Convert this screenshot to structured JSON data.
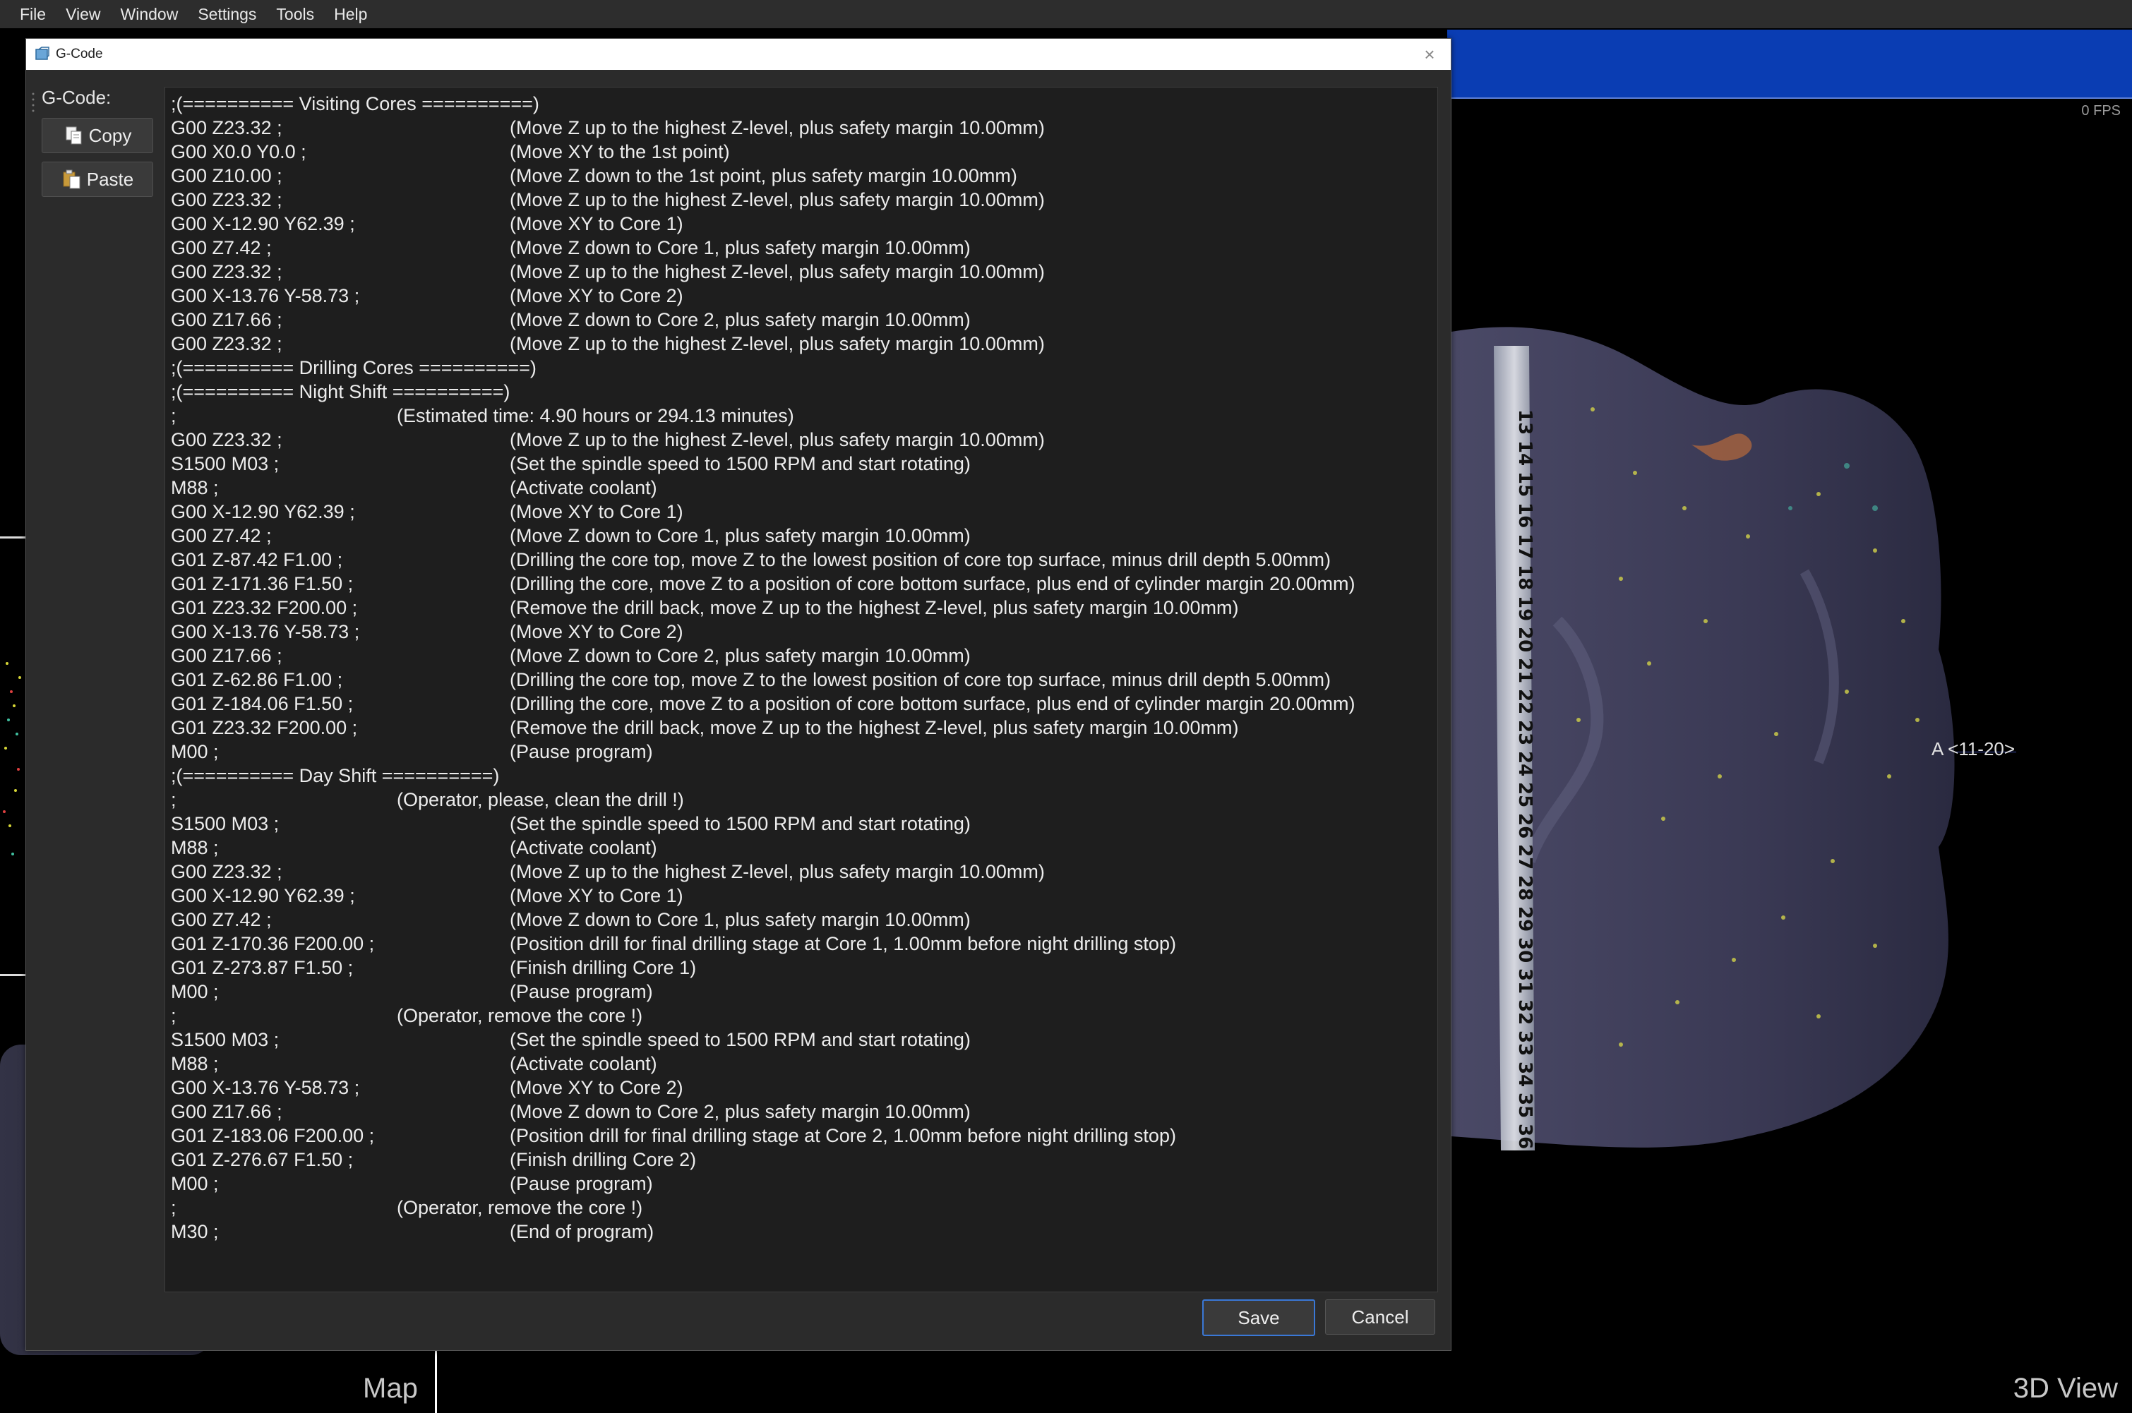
{
  "menu": [
    "File",
    "View",
    "Window",
    "Settings",
    "Tools",
    "Help"
  ],
  "viewport": {
    "fps": "0 FPS",
    "map_label": "Map",
    "view_label": "3D View",
    "axis_label": "A <11-20>"
  },
  "dialog": {
    "title": "G-Code",
    "gcode_label": "G-Code:",
    "copy_label": "Copy",
    "paste_label": "Paste",
    "save_label": "Save",
    "cancel_label": "Cancel",
    "lines": [
      {
        "c": ";(========== Visiting Cores ==========)",
        "m": ""
      },
      {
        "c": "G00 Z23.32 ;",
        "m": "(Move Z up to the highest Z-level, plus safety margin 10.00mm)"
      },
      {
        "c": "G00 X0.0 Y0.0 ;",
        "m": "(Move XY to the 1st point)"
      },
      {
        "c": "G00 Z10.00 ;",
        "m": "(Move Z down to the 1st point, plus safety margin 10.00mm)"
      },
      {
        "c": "G00 Z23.32 ;",
        "m": "(Move Z up to the highest Z-level, plus safety margin 10.00mm)"
      },
      {
        "c": "G00 X-12.90 Y62.39 ;",
        "m": "(Move XY to Core 1)"
      },
      {
        "c": "G00 Z7.42 ;",
        "m": "(Move Z down to Core 1, plus safety margin 10.00mm)"
      },
      {
        "c": "G00 Z23.32 ;",
        "m": "(Move Z up to the highest Z-level, plus safety margin 10.00mm)"
      },
      {
        "c": "G00 X-13.76 Y-58.73 ;",
        "m": "(Move XY to Core 2)"
      },
      {
        "c": "G00 Z17.66 ;",
        "m": "(Move Z down to Core 2, plus safety margin 10.00mm)"
      },
      {
        "c": "G00 Z23.32 ;",
        "m": "(Move Z up to the highest Z-level, plus safety margin 10.00mm)"
      },
      {
        "c": ";(========== Drilling Cores ==========)",
        "m": ""
      },
      {
        "c": ";(========== Night Shift ==========)",
        "m": ""
      },
      {
        "c": ";",
        "m": "(Estimated time: 4.90 hours or 294.13 minutes)",
        "center": true
      },
      {
        "c": "G00 Z23.32 ;",
        "m": "(Move Z up to the highest Z-level, plus safety margin 10.00mm)"
      },
      {
        "c": "S1500 M03 ;",
        "m": "(Set the spindle speed to 1500 RPM and start rotating)"
      },
      {
        "c": "M88 ;",
        "m": "(Activate coolant)"
      },
      {
        "c": "G00 X-12.90 Y62.39 ;",
        "m": "(Move XY to Core 1)"
      },
      {
        "c": "G00 Z7.42 ;",
        "m": "(Move Z down to Core 1, plus safety margin 10.00mm)"
      },
      {
        "c": "G01 Z-87.42 F1.00 ;",
        "m": "(Drilling the core top, move Z to the lowest position of core top surface, minus drill depth 5.00mm)"
      },
      {
        "c": "G01 Z-171.36 F1.50 ;",
        "m": "(Drilling the core, move Z to a position of core bottom surface, plus end of cylinder margin 20.00mm)"
      },
      {
        "c": "G01 Z23.32 F200.00 ;",
        "m": "(Remove the drill back, move Z up to the highest Z-level, plus safety margin 10.00mm)"
      },
      {
        "c": "G00 X-13.76 Y-58.73 ;",
        "m": "(Move XY to Core 2)"
      },
      {
        "c": "G00 Z17.66 ;",
        "m": "(Move Z down to Core 2, plus safety margin 10.00mm)"
      },
      {
        "c": "G01 Z-62.86 F1.00 ;",
        "m": "(Drilling the core top, move Z to the lowest position of core top surface, minus drill depth 5.00mm)"
      },
      {
        "c": "G01 Z-184.06 F1.50 ;",
        "m": "(Drilling the core, move Z to a position of core bottom surface, plus end of cylinder margin 20.00mm)"
      },
      {
        "c": "G01 Z23.32 F200.00 ;",
        "m": "(Remove the drill back, move Z up to the highest Z-level, plus safety margin 10.00mm)"
      },
      {
        "c": "M00 ;",
        "m": "(Pause program)"
      },
      {
        "c": ";(========== Day Shift ==========)",
        "m": ""
      },
      {
        "c": ";",
        "m": "(Operator, please, clean the drill !)",
        "center": true
      },
      {
        "c": "S1500 M03 ;",
        "m": "(Set the spindle speed to 1500 RPM and start rotating)"
      },
      {
        "c": "M88 ;",
        "m": "(Activate coolant)"
      },
      {
        "c": "G00 Z23.32 ;",
        "m": "(Move Z up to the highest Z-level, plus safety margin 10.00mm)"
      },
      {
        "c": "G00 X-12.90 Y62.39 ;",
        "m": "(Move XY to Core 1)"
      },
      {
        "c": "G00 Z7.42 ;",
        "m": "(Move Z down to Core 1, plus safety margin 10.00mm)"
      },
      {
        "c": "G01 Z-170.36 F200.00 ;",
        "m": "(Position drill for final drilling stage at Core 1, 1.00mm before night drilling stop)"
      },
      {
        "c": "G01 Z-273.87 F1.50 ;",
        "m": "(Finish drilling Core 1)"
      },
      {
        "c": "M00 ;",
        "m": "(Pause program)"
      },
      {
        "c": ";",
        "m": "(Operator, remove the core !)",
        "center": true
      },
      {
        "c": "S1500 M03 ;",
        "m": "(Set the spindle speed to 1500 RPM and start rotating)"
      },
      {
        "c": "M88 ;",
        "m": "(Activate coolant)"
      },
      {
        "c": "G00 X-13.76 Y-58.73 ;",
        "m": "(Move XY to Core 2)"
      },
      {
        "c": "G00 Z17.66 ;",
        "m": "(Move Z down to Core 2, plus safety margin 10.00mm)"
      },
      {
        "c": "G01 Z-183.06 F200.00 ;",
        "m": "(Position drill for final drilling stage at Core 2, 1.00mm before night drilling stop)"
      },
      {
        "c": "G01 Z-276.67 F1.50 ;",
        "m": "(Finish drilling Core 2)"
      },
      {
        "c": "M00 ;",
        "m": "(Pause program)"
      },
      {
        "c": ";",
        "m": "(Operator, remove the core !)",
        "center": true
      },
      {
        "c": "M30 ;",
        "m": "(End of program)"
      }
    ]
  },
  "ruler_numbers": [
    "13",
    "14",
    "15",
    "16",
    "17",
    "18",
    "19",
    "20",
    "21",
    "22",
    "23",
    "24",
    "25",
    "26",
    "27",
    "28",
    "29",
    "30",
    "31",
    "32",
    "33",
    "34",
    "35",
    "36"
  ],
  "colors": {
    "dialog_bg": "#2b2b2b",
    "code_bg": "#1e1e1e",
    "viewport_header": "#0a3db3",
    "object": "#3b3a55",
    "accent_button": "#3a78d6"
  }
}
